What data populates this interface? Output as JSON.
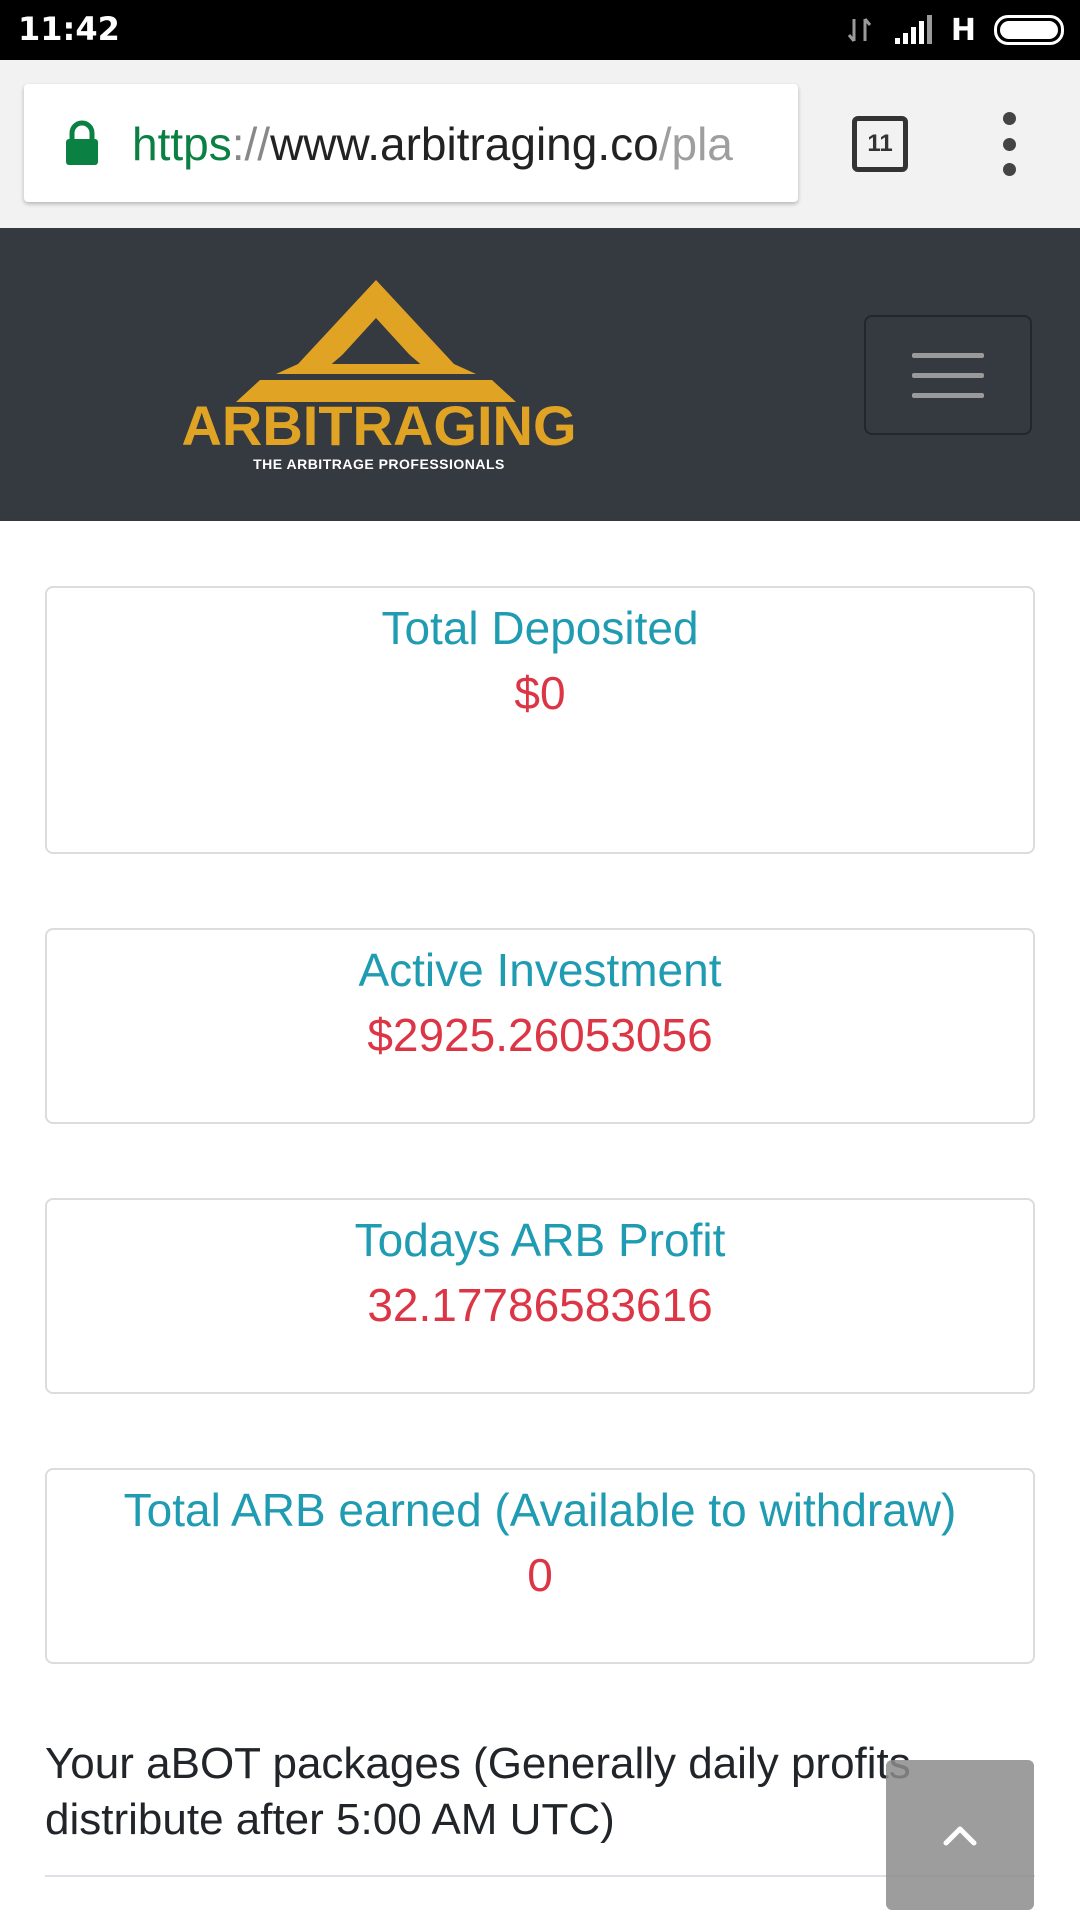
{
  "status_bar": {
    "time": "11:42",
    "network_type": "H",
    "icons": [
      "data-arrows-icon",
      "signal-icon",
      "battery-icon"
    ]
  },
  "browser": {
    "url": {
      "scheme": "https",
      "separator": "://",
      "host": "www.arbitraging.co",
      "path": "/pla"
    },
    "tab_count": "11",
    "icons": [
      "lock-icon",
      "tabs-icon",
      "more-options-icon"
    ],
    "colors": {
      "secure": "#0b8043"
    }
  },
  "site_header": {
    "logo_word": "ARBITRAGING",
    "logo_tagline": "THE ARBITRAGE PROFESSIONALS",
    "colors": {
      "background": "#343a40",
      "brand": "#e0a324"
    },
    "icons": [
      "logo-mark-icon",
      "hamburger-menu-icon"
    ]
  },
  "cards": [
    {
      "label": "Total Deposited",
      "value": "$0"
    },
    {
      "label": "Active Investment",
      "value": "$2925.26053056"
    },
    {
      "label": "Todays ARB Profit",
      "value": "32.17786583616"
    },
    {
      "label": "Total ARB earned (Available to withdraw)",
      "value": "0"
    }
  ],
  "card_colors": {
    "label": "#1f9bb2",
    "value": "#dc3545"
  },
  "packages": {
    "heading": "Your aBOT packages (Generally daily profits distribute after 5:00 AM UTC)"
  },
  "scroll_top_icon": "chevron-up-icon"
}
